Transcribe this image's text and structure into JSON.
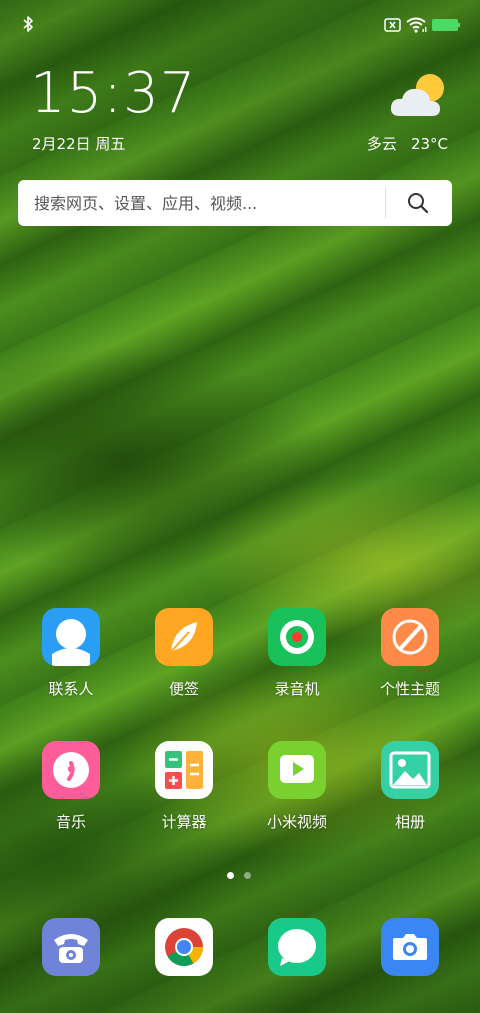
{
  "status_bar": {
    "icons": [
      "bluetooth-icon",
      "no-sim-icon",
      "wifi-icon",
      "battery-icon"
    ],
    "battery_color": "#4cd964"
  },
  "clock": {
    "time": "15:37",
    "date": "2月22日 周五"
  },
  "weather": {
    "icon": "partly-cloudy-icon",
    "condition": "多云",
    "temperature": "23°C"
  },
  "search": {
    "placeholder": "搜索网页、设置、应用、视频..."
  },
  "apps": [
    {
      "label": "联系人",
      "icon": "contacts-icon",
      "color": "#2a9df4"
    },
    {
      "label": "便签",
      "icon": "notes-icon",
      "color": "#ffa722"
    },
    {
      "label": "录音机",
      "icon": "recorder-icon",
      "color": "#18c15a"
    },
    {
      "label": "个性主题",
      "icon": "themes-icon",
      "color": "#ff8a47"
    },
    {
      "label": "音乐",
      "icon": "music-icon",
      "color": "#ff5c9a"
    },
    {
      "label": "计算器",
      "icon": "calculator-icon",
      "color": "#ffffff"
    },
    {
      "label": "小米视频",
      "icon": "video-icon",
      "color": "#7ad02f"
    },
    {
      "label": "相册",
      "icon": "gallery-icon",
      "color": "#35d0a4"
    }
  ],
  "pager": {
    "pages": 2,
    "current": 1
  },
  "dock": [
    {
      "icon": "phone-icon",
      "color": "#6f83d8"
    },
    {
      "icon": "chrome-icon",
      "color": "#ffffff"
    },
    {
      "icon": "messages-icon",
      "color": "#19c98a"
    },
    {
      "icon": "camera-icon",
      "color": "#3a86f5"
    }
  ]
}
